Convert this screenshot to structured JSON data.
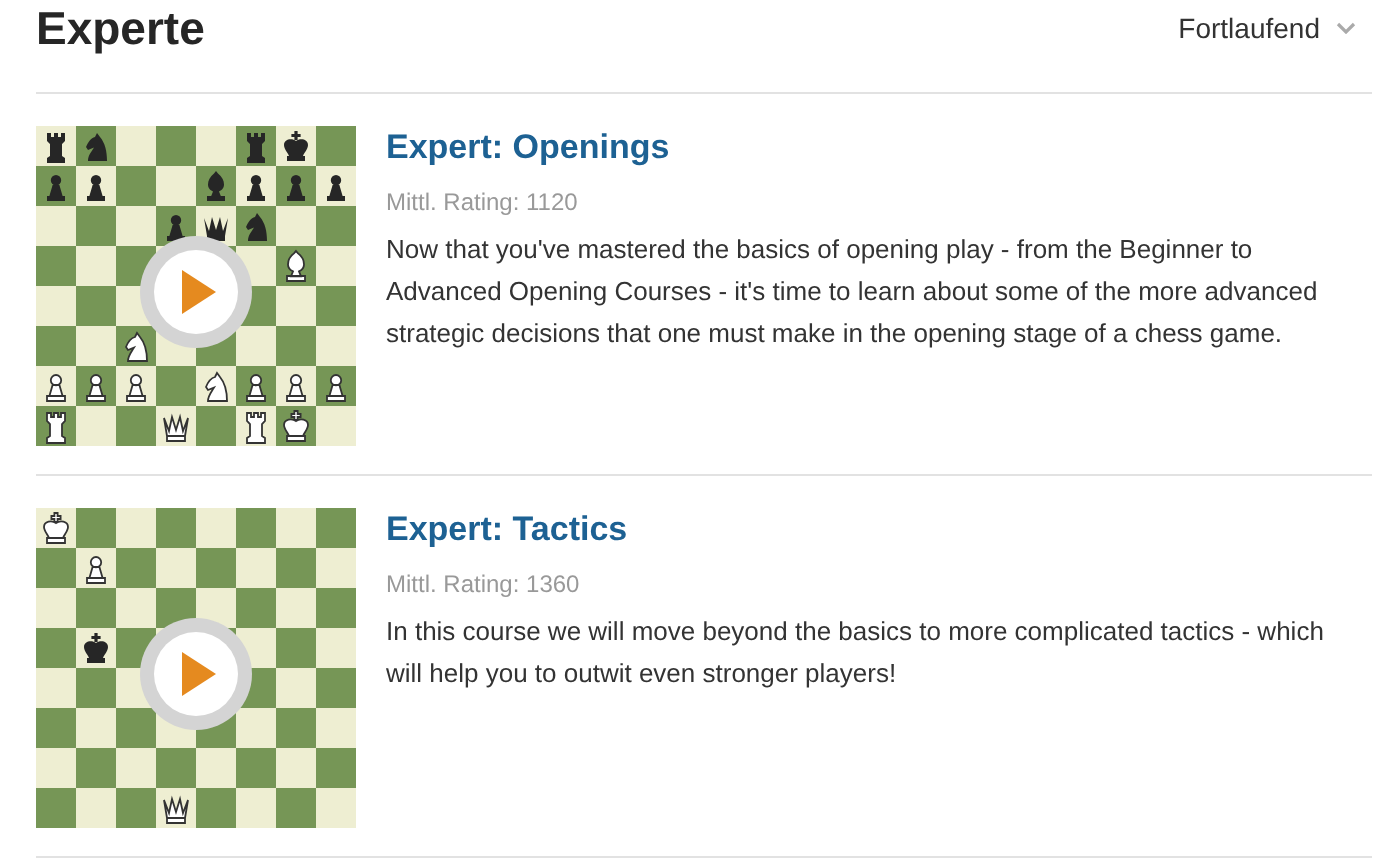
{
  "heading": "Experte",
  "sort": {
    "label": "Fortlaufend"
  },
  "courses": [
    {
      "title": "Expert: Openings",
      "rating": "Mittl. Rating: 1120",
      "description": "Now that you've mastered the basics of opening play - from the Beginner to Advanced Opening Courses - it's time to learn about some of the more advanced strategic decisions that one must make in the opening stage of a chess game."
    },
    {
      "title": "Expert: Tactics",
      "rating": "Mittl. Rating: 1360",
      "description": "In this course we will move beyond the basics to more complicated tactics - which will help you to outwit even stronger players!"
    }
  ]
}
